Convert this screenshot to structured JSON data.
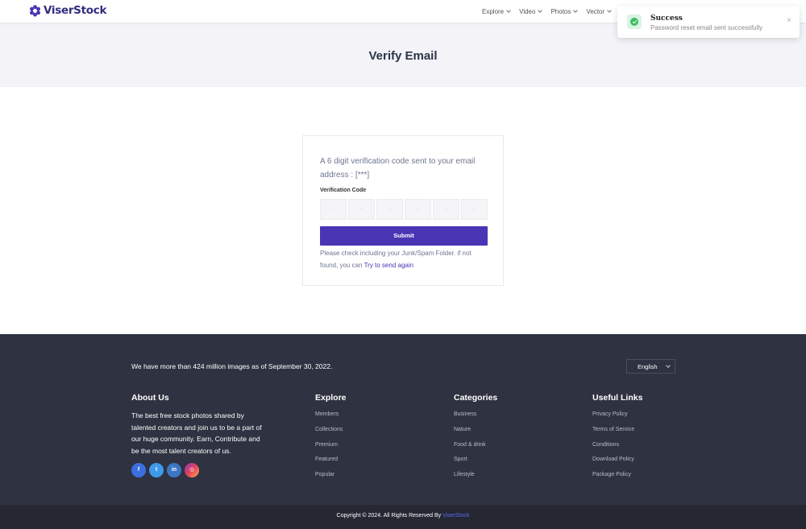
{
  "header": {
    "brand": "ViserStock",
    "nav": [
      "Explore",
      "Video",
      "Photos",
      "Vector"
    ],
    "accent": "#332e80"
  },
  "toast": {
    "title": "Success",
    "message": "Password reset email sent successfully",
    "close": "×",
    "status_color": "#3dbc5f"
  },
  "banner": {
    "title": "Verify Email"
  },
  "verify": {
    "message": "A 6 digit verification code sent to your email address : [***]",
    "code_label": "Verification Code",
    "code_digits": [
      "-",
      "-",
      "-",
      "-",
      "-",
      "-"
    ],
    "submit_label": "Submit",
    "note": "Please check including your Junk/Spam Folder. if not found, you can",
    "resend_link": "Try to send again",
    "button_color": "#4a35b5"
  },
  "footer": {
    "intro": "We have more than 424 million images as of September 30, 2022.",
    "language": "English",
    "about": {
      "title": "About Us",
      "text": "The best free stock photos shared by talented creators and join us to be a part of our huge community. Earn, Contribute and be the most talent creators of us.",
      "socials": [
        {
          "icon": "facebook-icon",
          "glyph": "f",
          "color": "#3b6fe0"
        },
        {
          "icon": "twitter-icon",
          "glyph": "t",
          "color": "#3d9be9"
        },
        {
          "icon": "linkedin-icon",
          "glyph": "in",
          "color": "#3a76c4"
        },
        {
          "icon": "instagram-icon",
          "glyph": "◎",
          "color": "#d6456d"
        }
      ]
    },
    "explore": {
      "title": "Explore",
      "items": [
        "Members",
        "Collections",
        "Premium",
        "Featured",
        "Popular"
      ]
    },
    "categories": {
      "title": "Categories",
      "items": [
        "Business",
        "Nature",
        "Food & drink",
        "Sport",
        "Lifestyle"
      ]
    },
    "links": {
      "title": "Useful Links",
      "items": [
        "Privacy Policy",
        "Terms of Service",
        "Conditions",
        "Download Policy",
        "Package Policy"
      ]
    }
  },
  "copyright": {
    "text": "Copyright © 2024. All Rights Reserved By",
    "brand": "ViserStock"
  }
}
